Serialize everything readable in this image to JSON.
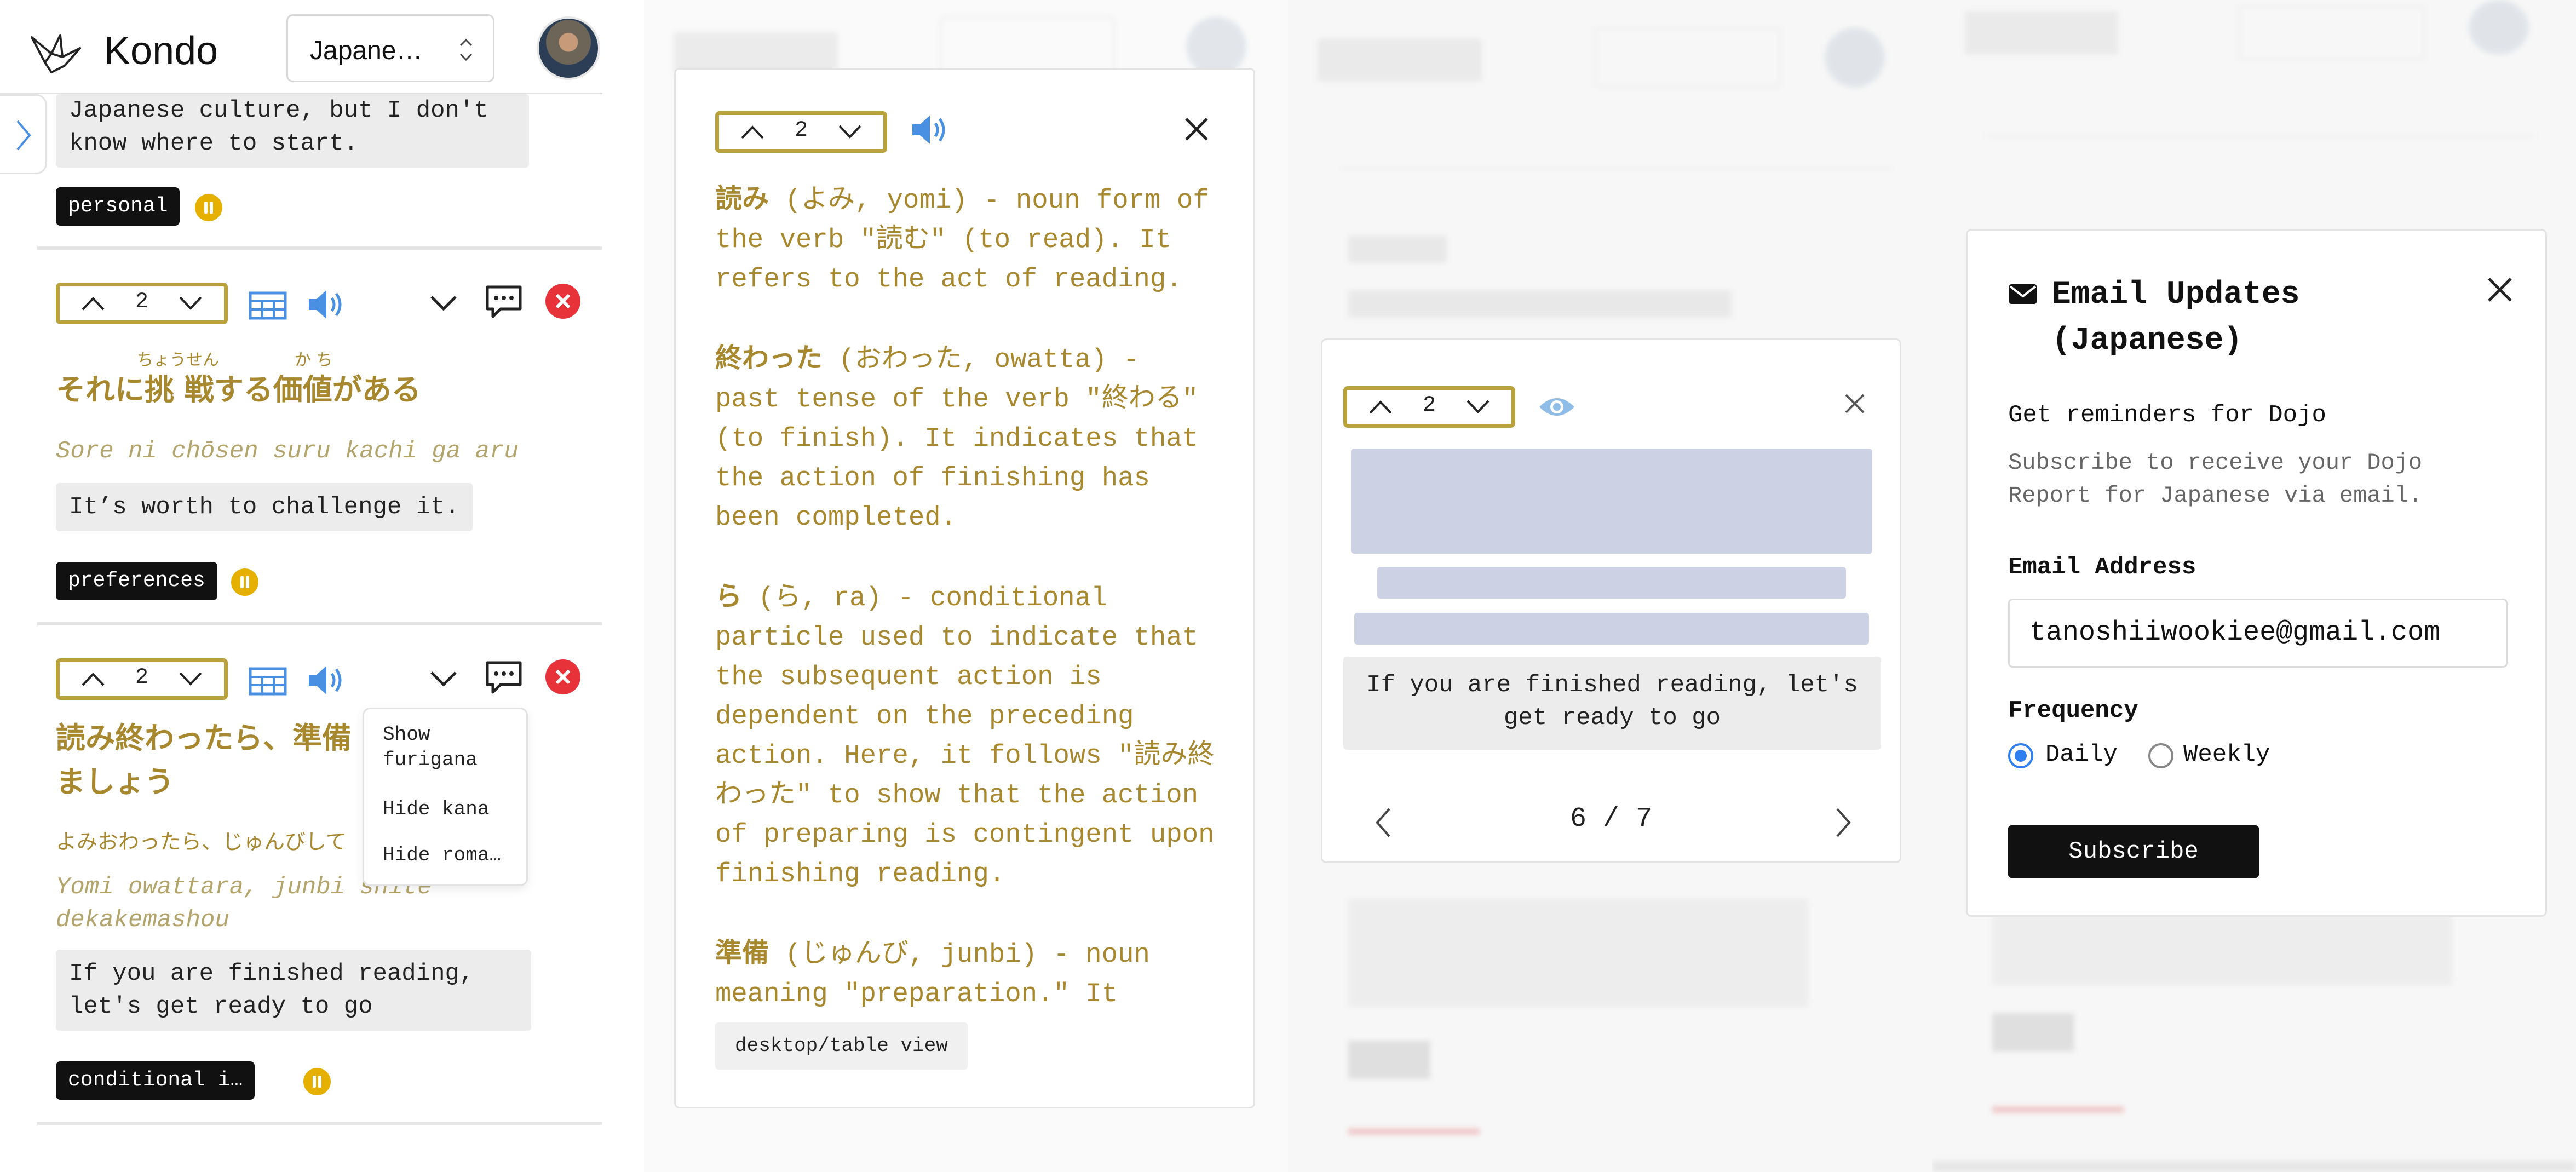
{
  "app": {
    "name": "Kondo",
    "language_select": "Japane…"
  },
  "cardA1": {
    "text": "Japanese culture, but I don't know where to start.",
    "tag": "personal"
  },
  "cardA2": {
    "stepper_value": "2",
    "furigana_1": "ちょうせん",
    "furigana_2": "か ち",
    "japanese": "それに挑 戦する価値がある",
    "romaji": "Sore ni chōsen suru kachi ga aru",
    "translation": "It’s worth to challenge it.",
    "tag": "preferences"
  },
  "cardA3": {
    "stepper_value": "2",
    "japanese_line1": "読み終わったら、準備",
    "japanese_line2": "ましょう",
    "kana": "よみおわったら、じゅんびして",
    "romaji": "Yomi owattara, junbi shite dekakemashou",
    "translation": "If you are finished reading, let's get ready to go",
    "tag": "conditional i…"
  },
  "menu": {
    "items": [
      "Show furigana",
      "Hide kana",
      "Hide roma…"
    ]
  },
  "explanation": {
    "stepper_value": "2",
    "paragraphs": [
      {
        "term": "読み",
        "rest": " (よみ, yomi) - noun form of the verb \"読む\" (to read). It refers to the act of reading."
      },
      {
        "term": "終わった",
        "rest": " (おわった, owatta) - past tense of the verb \"終わる\" (to finish). It indicates that the action of finishing has been completed."
      },
      {
        "term": "ら",
        "rest": " (ら, ra) - conditional particle used to indicate that the subsequent action is dependent on the preceding action. Here, it follows \"読み終わった\" to show that the action of preparing is contingent upon finishing reading."
      },
      {
        "term": "準備",
        "rest": " (じゅんび, junbi) - noun meaning \"preparation.\" It"
      }
    ],
    "view_chip": "desktop/table view"
  },
  "reading_card": {
    "stepper_value": "2",
    "answer": "If you are finished reading, let's get ready to go",
    "pager": "6 / 7"
  },
  "email_modal": {
    "title": "Email Updates (Japanese)",
    "heading": "Get reminders for Dojo",
    "description": "Subscribe to receive your Dojo Report for Japanese via email.",
    "email_label": "Email Address",
    "email_value": "tanoshiiwookiee@gmail.com",
    "frequency_label": "Frequency",
    "option_daily": "Daily",
    "option_weekly": "Weekly",
    "subscribe": "Subscribe"
  },
  "colors": {
    "accent_gold": "#b9a13c",
    "text_gold": "#a8882e",
    "blue": "#4a90e2",
    "red": "#e8323a",
    "pause_yellow": "#e5b000"
  }
}
